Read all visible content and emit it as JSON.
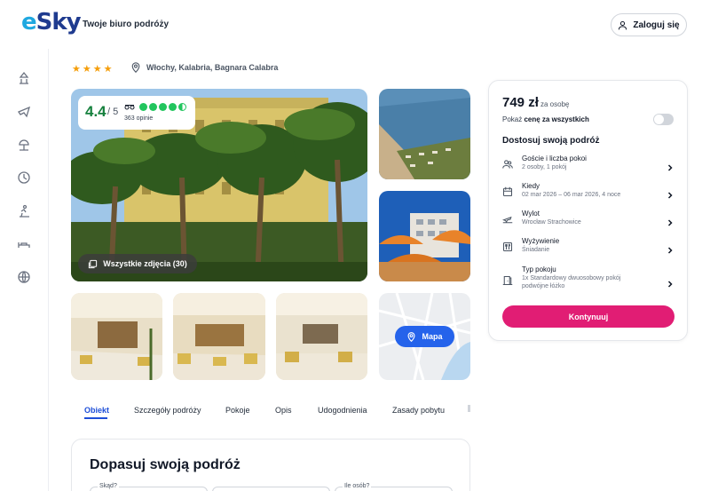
{
  "header": {
    "logo": "eSky",
    "tagline": "Twoje biuro podróży",
    "login_label": "Zaloguj się"
  },
  "rail": {
    "icons": [
      "hotel-icon",
      "flight-icon",
      "beach-icon",
      "clock-icon",
      "ski-icon",
      "bed-icon",
      "globe-icon"
    ]
  },
  "hotel": {
    "stars": "★★★★",
    "location": "Włochy, Kalabria, Bagnara Calabra",
    "rating": "4.4",
    "rating_scale": "/ 5",
    "opinions": "363 opinie",
    "tripadvisor_score": 4.5,
    "all_photos_label": "Wszystkie zdjęcia (30)",
    "map_label": "Mapa"
  },
  "tabs": [
    {
      "label": "Obiekt",
      "active": true
    },
    {
      "label": "Szczegóły podróży",
      "active": false
    },
    {
      "label": "Pokoje",
      "active": false
    },
    {
      "label": "Opis",
      "active": false
    },
    {
      "label": "Udogodnienia",
      "active": false
    },
    {
      "label": "Zasady pobytu",
      "active": false
    }
  ],
  "fit_section": {
    "title": "Dopasuj swoją podróż",
    "from_label": "Skąd?",
    "guests_label": "Ile osób?"
  },
  "booking": {
    "price": "749 zł",
    "price_note": "za osobę",
    "toggle_prefix": "Pokaż",
    "toggle_bold": "cenę za wszystkich",
    "customize_title": "Dostosuj swoją podróż",
    "rows": [
      {
        "title": "Goście i liczba pokoi",
        "sub": "2 osoby, 1 pokój",
        "sub2": "",
        "icon": "guests-icon"
      },
      {
        "title": "Kiedy",
        "sub": "02 mar 2026 – 06 mar 2026, 4 noce",
        "sub2": "",
        "icon": "calendar-icon"
      },
      {
        "title": "Wylot",
        "sub": "Wrocław Strachowice",
        "sub2": "",
        "icon": "departure-icon"
      },
      {
        "title": "Wyżywienie",
        "sub": "Śniadanie",
        "sub2": "",
        "icon": "meal-icon"
      },
      {
        "title": "Typ pokoju",
        "sub": "1x Standardowy dwuosobowy pokój",
        "sub2": "podwójne łóżko",
        "icon": "room-icon"
      }
    ],
    "cta_label": "Kontynuuj"
  }
}
